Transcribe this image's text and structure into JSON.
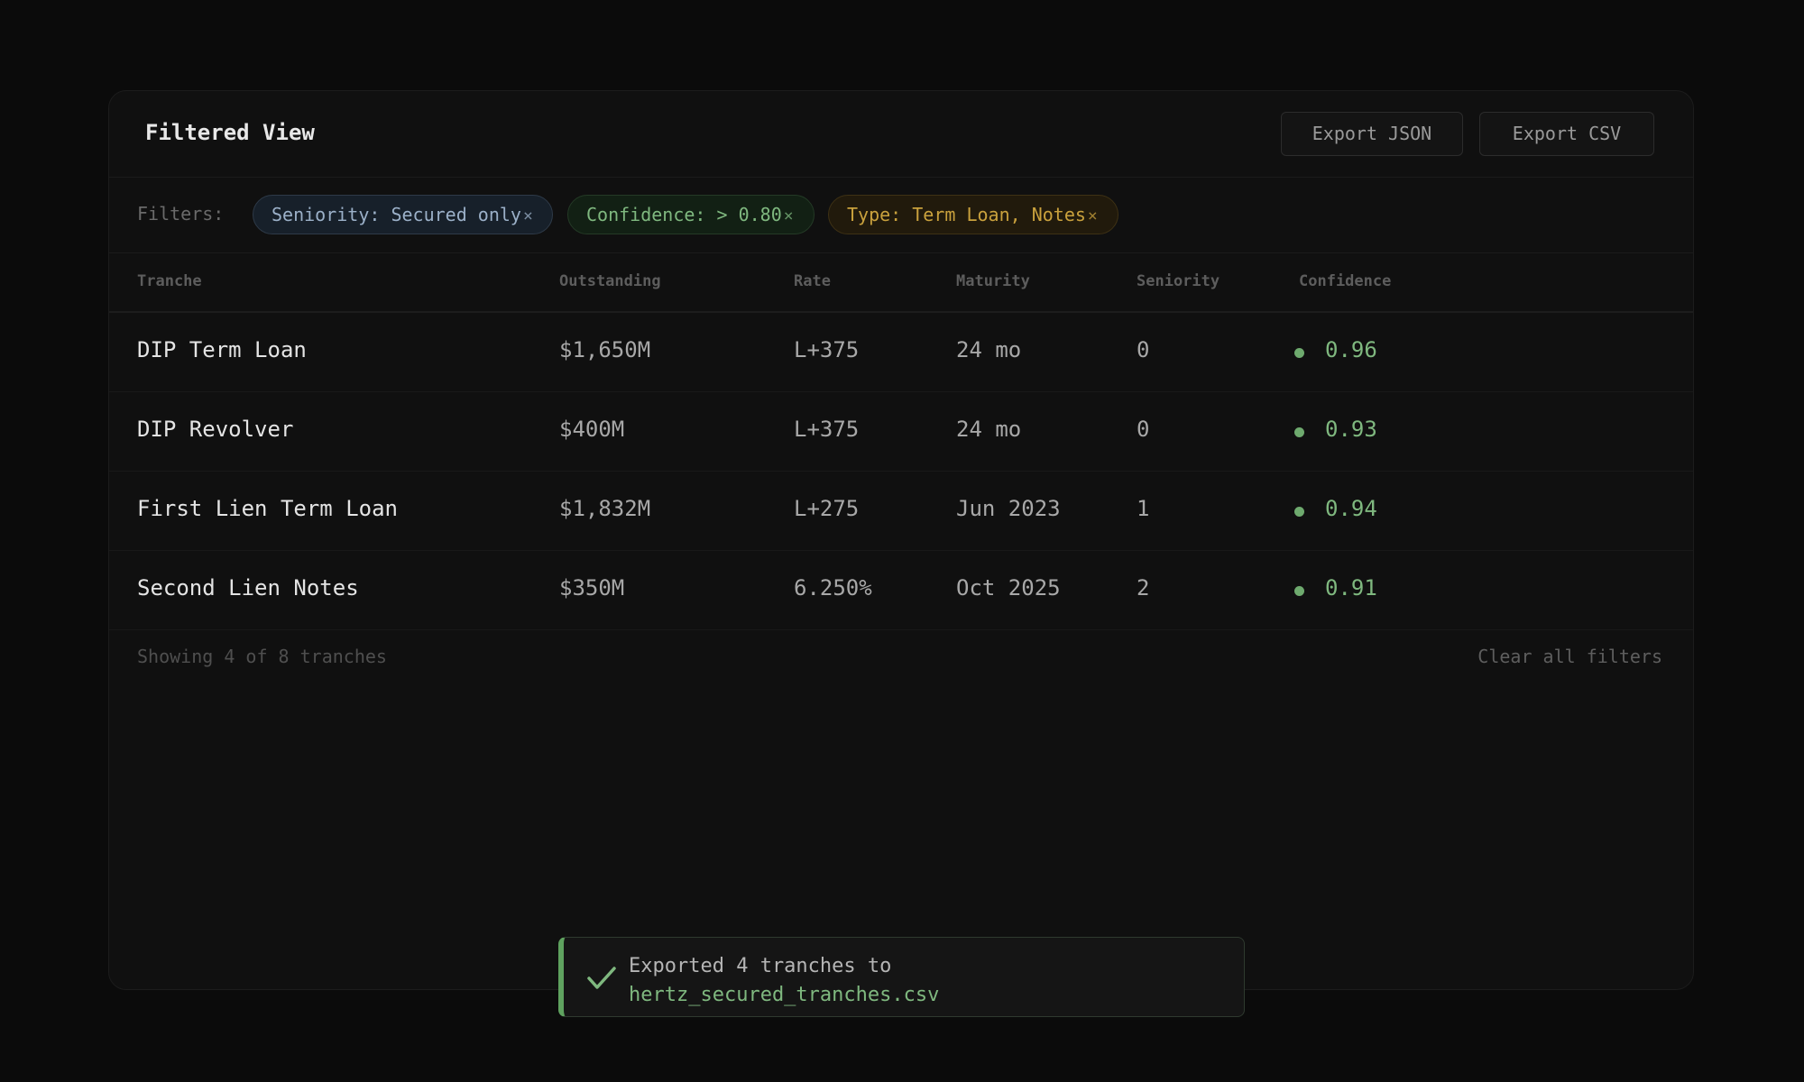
{
  "header": {
    "title": "Filtered View",
    "export_json_label": "Export JSON",
    "export_csv_label": "Export CSV"
  },
  "filters": {
    "label": "Filters:",
    "chips": [
      {
        "text": "Seniority: Secured only",
        "close": "×",
        "color": "#9bb0c8"
      },
      {
        "text": "Confidence: > 0.80",
        "close": "×",
        "color": "#7fb87f"
      },
      {
        "text": "Type: Term Loan, Notes",
        "close": "×",
        "color": "#c9a13d"
      }
    ]
  },
  "table": {
    "columns": [
      "Tranche",
      "Outstanding",
      "Rate",
      "Maturity",
      "Seniority",
      "Confidence"
    ],
    "rows": [
      {
        "tranche": "DIP Term Loan",
        "outstanding": "$1,650M",
        "rate": "L+375",
        "maturity": "24 mo",
        "seniority": "0",
        "confidence": "0.96"
      },
      {
        "tranche": "DIP Revolver",
        "outstanding": "$400M",
        "rate": "L+375",
        "maturity": "24 mo",
        "seniority": "0",
        "confidence": "0.93"
      },
      {
        "tranche": "First Lien Term Loan",
        "outstanding": "$1,832M",
        "rate": "L+275",
        "maturity": "Jun 2023",
        "seniority": "1",
        "confidence": "0.94"
      },
      {
        "tranche": "Second Lien Notes",
        "outstanding": "$350M",
        "rate": "6.250%",
        "maturity": "Oct 2025",
        "seniority": "2",
        "confidence": "0.91"
      }
    ]
  },
  "footer": {
    "showing": "Showing 4 of 8 tranches",
    "clear_all": "Clear all filters"
  },
  "toast": {
    "icon": "check-icon",
    "message": "Exported 4 tranches to",
    "filename": "hertz_secured_tranches.csv",
    "accent_color": "#5fa25f"
  },
  "colors": {
    "background": "#0b0b0b",
    "confidence_green": "#7fb87f"
  }
}
